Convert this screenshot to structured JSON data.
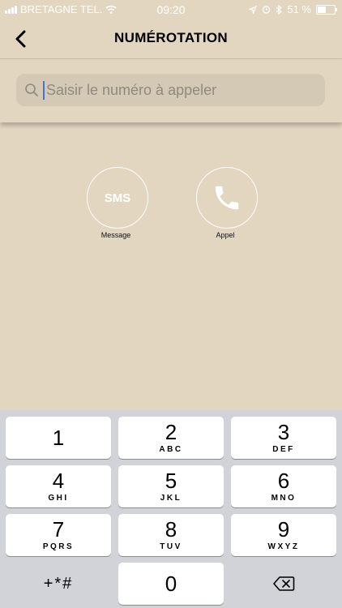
{
  "status": {
    "carrier": "BRETAGNE TEL.",
    "time": "09:20",
    "battery_text": "51 %",
    "battery_level": 0.51,
    "icons": [
      "signal-icon",
      "wifi-icon",
      "location-icon",
      "alarm-icon",
      "bluetooth-icon",
      "battery-icon"
    ]
  },
  "nav": {
    "title": "NUMÉROTATION",
    "back_icon": "chevron-left-icon"
  },
  "search": {
    "placeholder": "Saisir le numéro à appeler",
    "value": "",
    "icon": "search-icon"
  },
  "actions": {
    "sms": {
      "text": "SMS",
      "label": "Message"
    },
    "call": {
      "label": "Appel",
      "icon": "phone-icon"
    }
  },
  "keypad": {
    "keys": [
      {
        "digit": "1",
        "letters": ""
      },
      {
        "digit": "2",
        "letters": "ABC"
      },
      {
        "digit": "3",
        "letters": "DEF"
      },
      {
        "digit": "4",
        "letters": "GHI"
      },
      {
        "digit": "5",
        "letters": "JKL"
      },
      {
        "digit": "6",
        "letters": "MNO"
      },
      {
        "digit": "7",
        "letters": "PQRS"
      },
      {
        "digit": "8",
        "letters": "TUV"
      },
      {
        "digit": "9",
        "letters": "WXYZ"
      },
      {
        "digit": "0",
        "letters": ""
      }
    ],
    "symbols_label": "+*#",
    "delete_icon": "backspace-icon"
  },
  "colors": {
    "background": "#e2d6c0",
    "search_field": "#d4c9b5",
    "keypad_bg": "#d1d3d9",
    "cursor": "#4a6fd8"
  }
}
